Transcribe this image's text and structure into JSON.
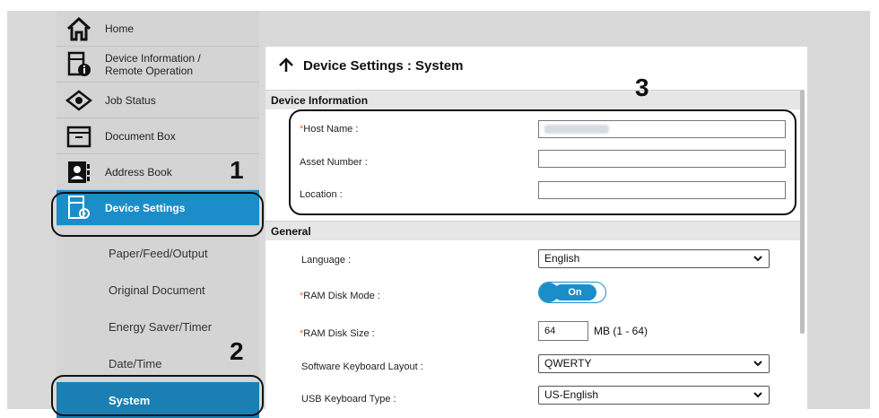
{
  "sidebar": {
    "items": [
      {
        "label": "Home",
        "icon": "home-icon"
      },
      {
        "label": "Device Information / Remote Operation",
        "line1": "Device Information /",
        "line2": "Remote Operation",
        "icon": "device-info-icon"
      },
      {
        "label": "Job Status",
        "icon": "job-status-icon"
      },
      {
        "label": "Document Box",
        "icon": "document-box-icon"
      },
      {
        "label": "Address Book",
        "icon": "address-book-icon"
      },
      {
        "label": "Device Settings",
        "icon": "device-settings-icon"
      }
    ],
    "subitems": [
      "Paper/Feed/Output",
      "Original Document",
      "Energy Saver/Timer",
      "Date/Time",
      "System"
    ]
  },
  "main": {
    "title": "Device Settings : System",
    "sections": {
      "device_info": "Device Information",
      "general": "General"
    },
    "fields": {
      "host_name": "Host Name :",
      "asset_number": "Asset Number :",
      "location": "Location :",
      "language": "Language :",
      "language_value": "English",
      "ram_disk_mode": "RAM Disk Mode :",
      "ram_disk_mode_value": "On",
      "ram_disk_size": "RAM Disk Size :",
      "ram_disk_size_value": "64",
      "ram_disk_unit": "MB (1 - 64)",
      "keyboard_layout": "Software Keyboard Layout :",
      "keyboard_layout_value": "QWERTY",
      "usb_keyboard": "USB Keyboard Type :",
      "usb_keyboard_value": "US-English"
    }
  },
  "callouts": {
    "one": "1",
    "two": "2",
    "three": "3"
  },
  "colors": {
    "accent": "#1b8ec9",
    "required": "#e8722d"
  }
}
